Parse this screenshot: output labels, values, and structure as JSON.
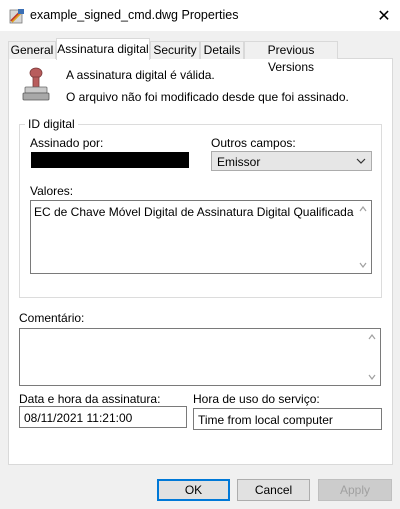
{
  "window": {
    "title": "example_signed_cmd.dwg Properties",
    "close_label": "✕"
  },
  "tabs": [
    {
      "label": "General"
    },
    {
      "label": "Assinatura digital"
    },
    {
      "label": "Security"
    },
    {
      "label": "Details"
    },
    {
      "label": "Previous Versions"
    }
  ],
  "status": {
    "line1": "A assinatura digital é válida.",
    "line2": "O arquivo não foi modificado desde que foi assinado."
  },
  "id_group": {
    "title": "ID digital",
    "signed_by_label": "Assinado por:",
    "other_fields_label": "Outros campos:",
    "other_fields_value": "Emissor",
    "values_label": "Valores:",
    "values_text": "EC de Chave Móvel Digital de Assinatura Digital Qualificada do"
  },
  "comment": {
    "label": "Comentário:"
  },
  "timestamp": {
    "date_label": "Data e hora da assinatura:",
    "date_value": "08/11/2021  11:21:00",
    "service_label": "Hora de uso do serviço:",
    "service_value": "Time from local computer"
  },
  "buttons": {
    "ok": "OK",
    "cancel": "Cancel",
    "apply": "Apply"
  }
}
